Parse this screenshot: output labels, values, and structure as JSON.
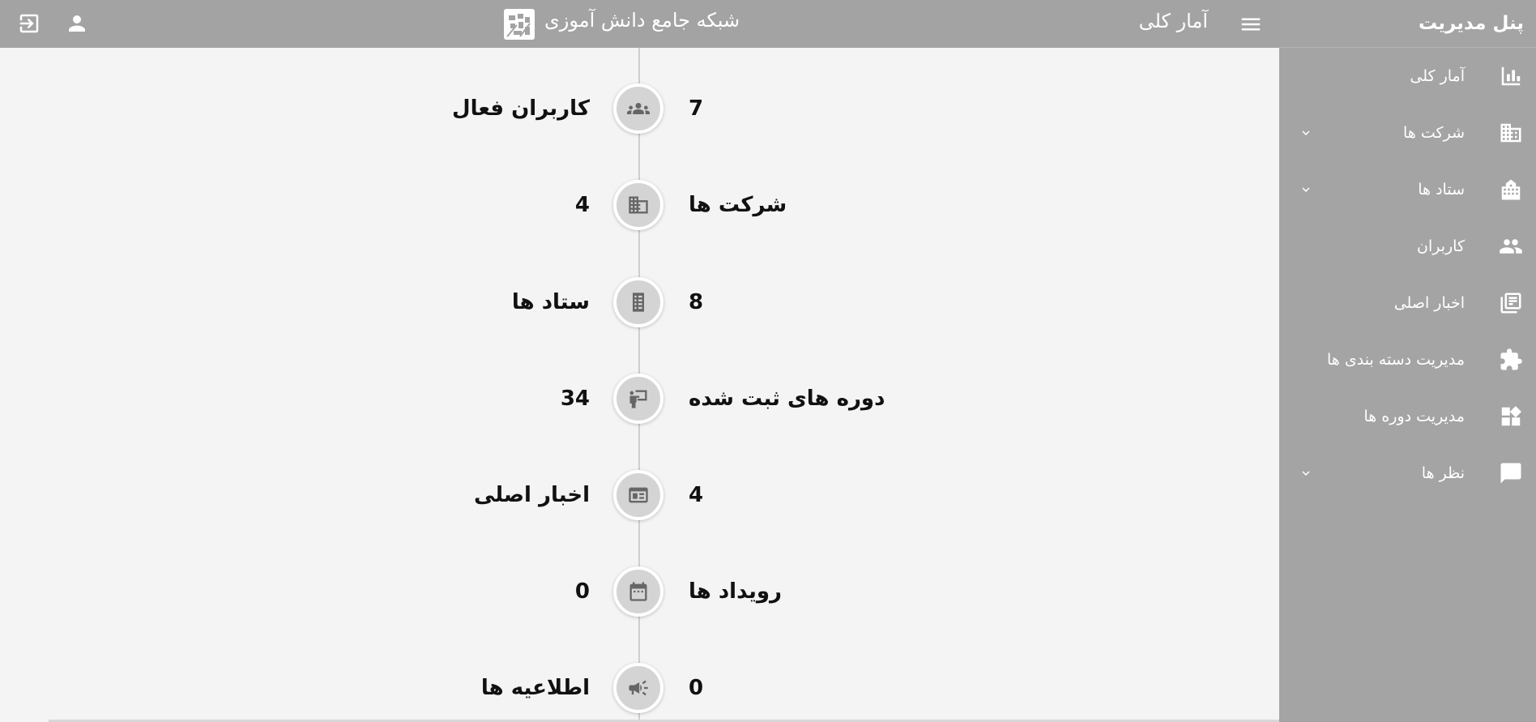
{
  "sidebar": {
    "title": "پنل مدیریت",
    "items": [
      {
        "label": "آمار کلی",
        "icon": "bar-chart-icon",
        "has_submenu": false
      },
      {
        "label": "شرکت ها",
        "icon": "office-building-icon",
        "has_submenu": true
      },
      {
        "label": "ستاد ها",
        "icon": "headquarters-icon",
        "has_submenu": true
      },
      {
        "label": "کاربران",
        "icon": "users-icon",
        "has_submenu": false
      },
      {
        "label": "اخبار اصلی",
        "icon": "newspaper-icon",
        "has_submenu": false
      },
      {
        "label": "مدیریت دسته بندی ها",
        "icon": "puzzle-icon",
        "has_submenu": false
      },
      {
        "label": "مدیریت دوره ها",
        "icon": "widgets-icon",
        "has_submenu": false
      },
      {
        "label": "نظر ها",
        "icon": "comment-icon",
        "has_submenu": true
      }
    ]
  },
  "topbar": {
    "page_title": "آمار کلی",
    "site_name": "شبکه جامع دانش آموزی",
    "menu_icon": "hamburger-menu-icon",
    "user_icon": "user-icon",
    "logout_icon": "logout-icon"
  },
  "stats": [
    {
      "label": "کاربران فعال",
      "value": "7",
      "icon": "group-icon"
    },
    {
      "label": "شرکت ها",
      "value": "4",
      "icon": "building-icon"
    },
    {
      "label": "ستاد ها",
      "value": "8",
      "icon": "tall-building-icon"
    },
    {
      "label": "دوره های ثبت شده",
      "value": "34",
      "icon": "teacher-board-icon"
    },
    {
      "label": "اخبار اصلی",
      "value": "4",
      "icon": "news-icon"
    },
    {
      "label": "رویداد ها",
      "value": "0",
      "icon": "calendar-icon"
    },
    {
      "label": "اطلاعیه ها",
      "value": "0",
      "icon": "megaphone-icon"
    }
  ],
  "colors": {
    "sidebar_bg": "#a4a4a4",
    "topbar_bg": "#a3a3a3",
    "content_bg": "#f4f4f4",
    "circle_bg": "#d4d4d4",
    "icon_dark": "#666666"
  }
}
